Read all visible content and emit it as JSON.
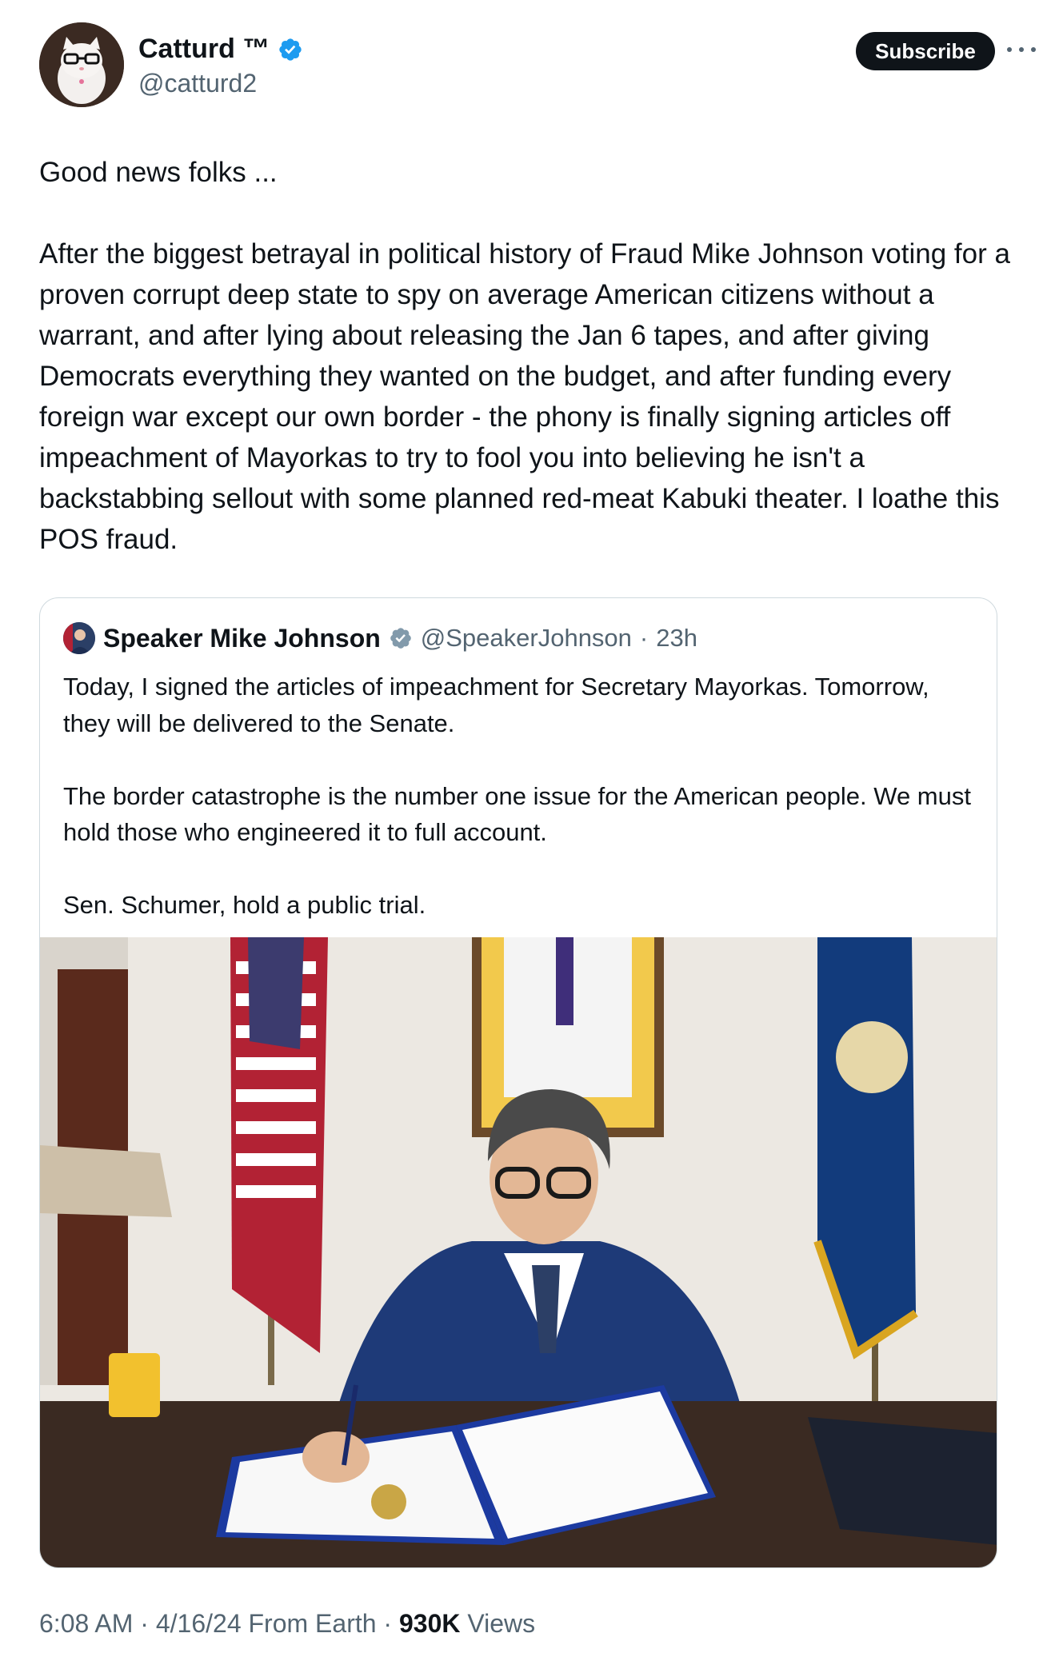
{
  "author": {
    "display_name": "Catturd ™",
    "handle": "@catturd2",
    "verified": true,
    "avatar_icon": "cat-with-glasses-avatar"
  },
  "actions": {
    "subscribe_label": "Subscribe",
    "more_icon": "more-horizontal-icon"
  },
  "tweet": {
    "text": "Good news folks ...\n\nAfter the biggest betrayal in political history of Fraud Mike Johnson voting for a proven corrupt deep state to spy on average American citizens without a warrant, and after lying about releasing the Jan 6 tapes, and after giving Democrats everything they wanted on the budget, and after funding every foreign war except our own border - the phony is finally signing articles off impeachment of Mayorkas to try to fool you into believing he isn't a backstabbing sellout with some planned red-meat Kabuki theater. I loathe this POS fraud."
  },
  "quoted_tweet": {
    "display_name": "Speaker Mike Johnson",
    "handle": "@SpeakerJohnson",
    "separator": "·",
    "time": "23h",
    "badge": "gray-verified-badge",
    "text": "Today, I signed the articles of impeachment for Secretary Mayorkas. Tomorrow, they will be delivered to the Senate.\n\nThe border catastrophe is the number one issue for the American people. We must hold those who engineered it to full account.\n\nSen. Schumer, hold a public trial.",
    "photo_icon": "speaker-signing-documents-photo"
  },
  "footer": {
    "time": "6:08 AM",
    "sep1": "·",
    "date": "4/16/24",
    "source": "From Earth",
    "sep2": "·",
    "views_count": "930K",
    "views_label": "Views"
  },
  "colors": {
    "text_primary": "#0f1419",
    "text_secondary": "#536471",
    "verified_blue": "#1d9bf0",
    "border": "#cfd9de"
  }
}
